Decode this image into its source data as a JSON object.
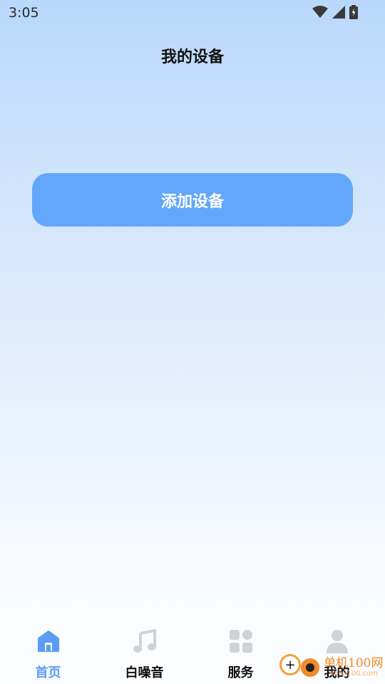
{
  "status_bar": {
    "time": "3:05"
  },
  "header": {
    "title": "我的设备"
  },
  "main": {
    "add_device_label": "添加设备"
  },
  "tabs": [
    {
      "label": "首页",
      "icon": "home-icon",
      "active": true
    },
    {
      "label": "白噪音",
      "icon": "music-note-icon",
      "active": false
    },
    {
      "label": "服务",
      "icon": "grid-icon",
      "active": false
    },
    {
      "label": "我的",
      "icon": "user-icon",
      "active": false
    }
  ],
  "watermark": {
    "brand": "单机100网",
    "url": "danji100.com"
  },
  "colors": {
    "accent": "#63a7fb",
    "active_tab": "#5a9df6",
    "inactive_icon": "#cfd2d8"
  }
}
